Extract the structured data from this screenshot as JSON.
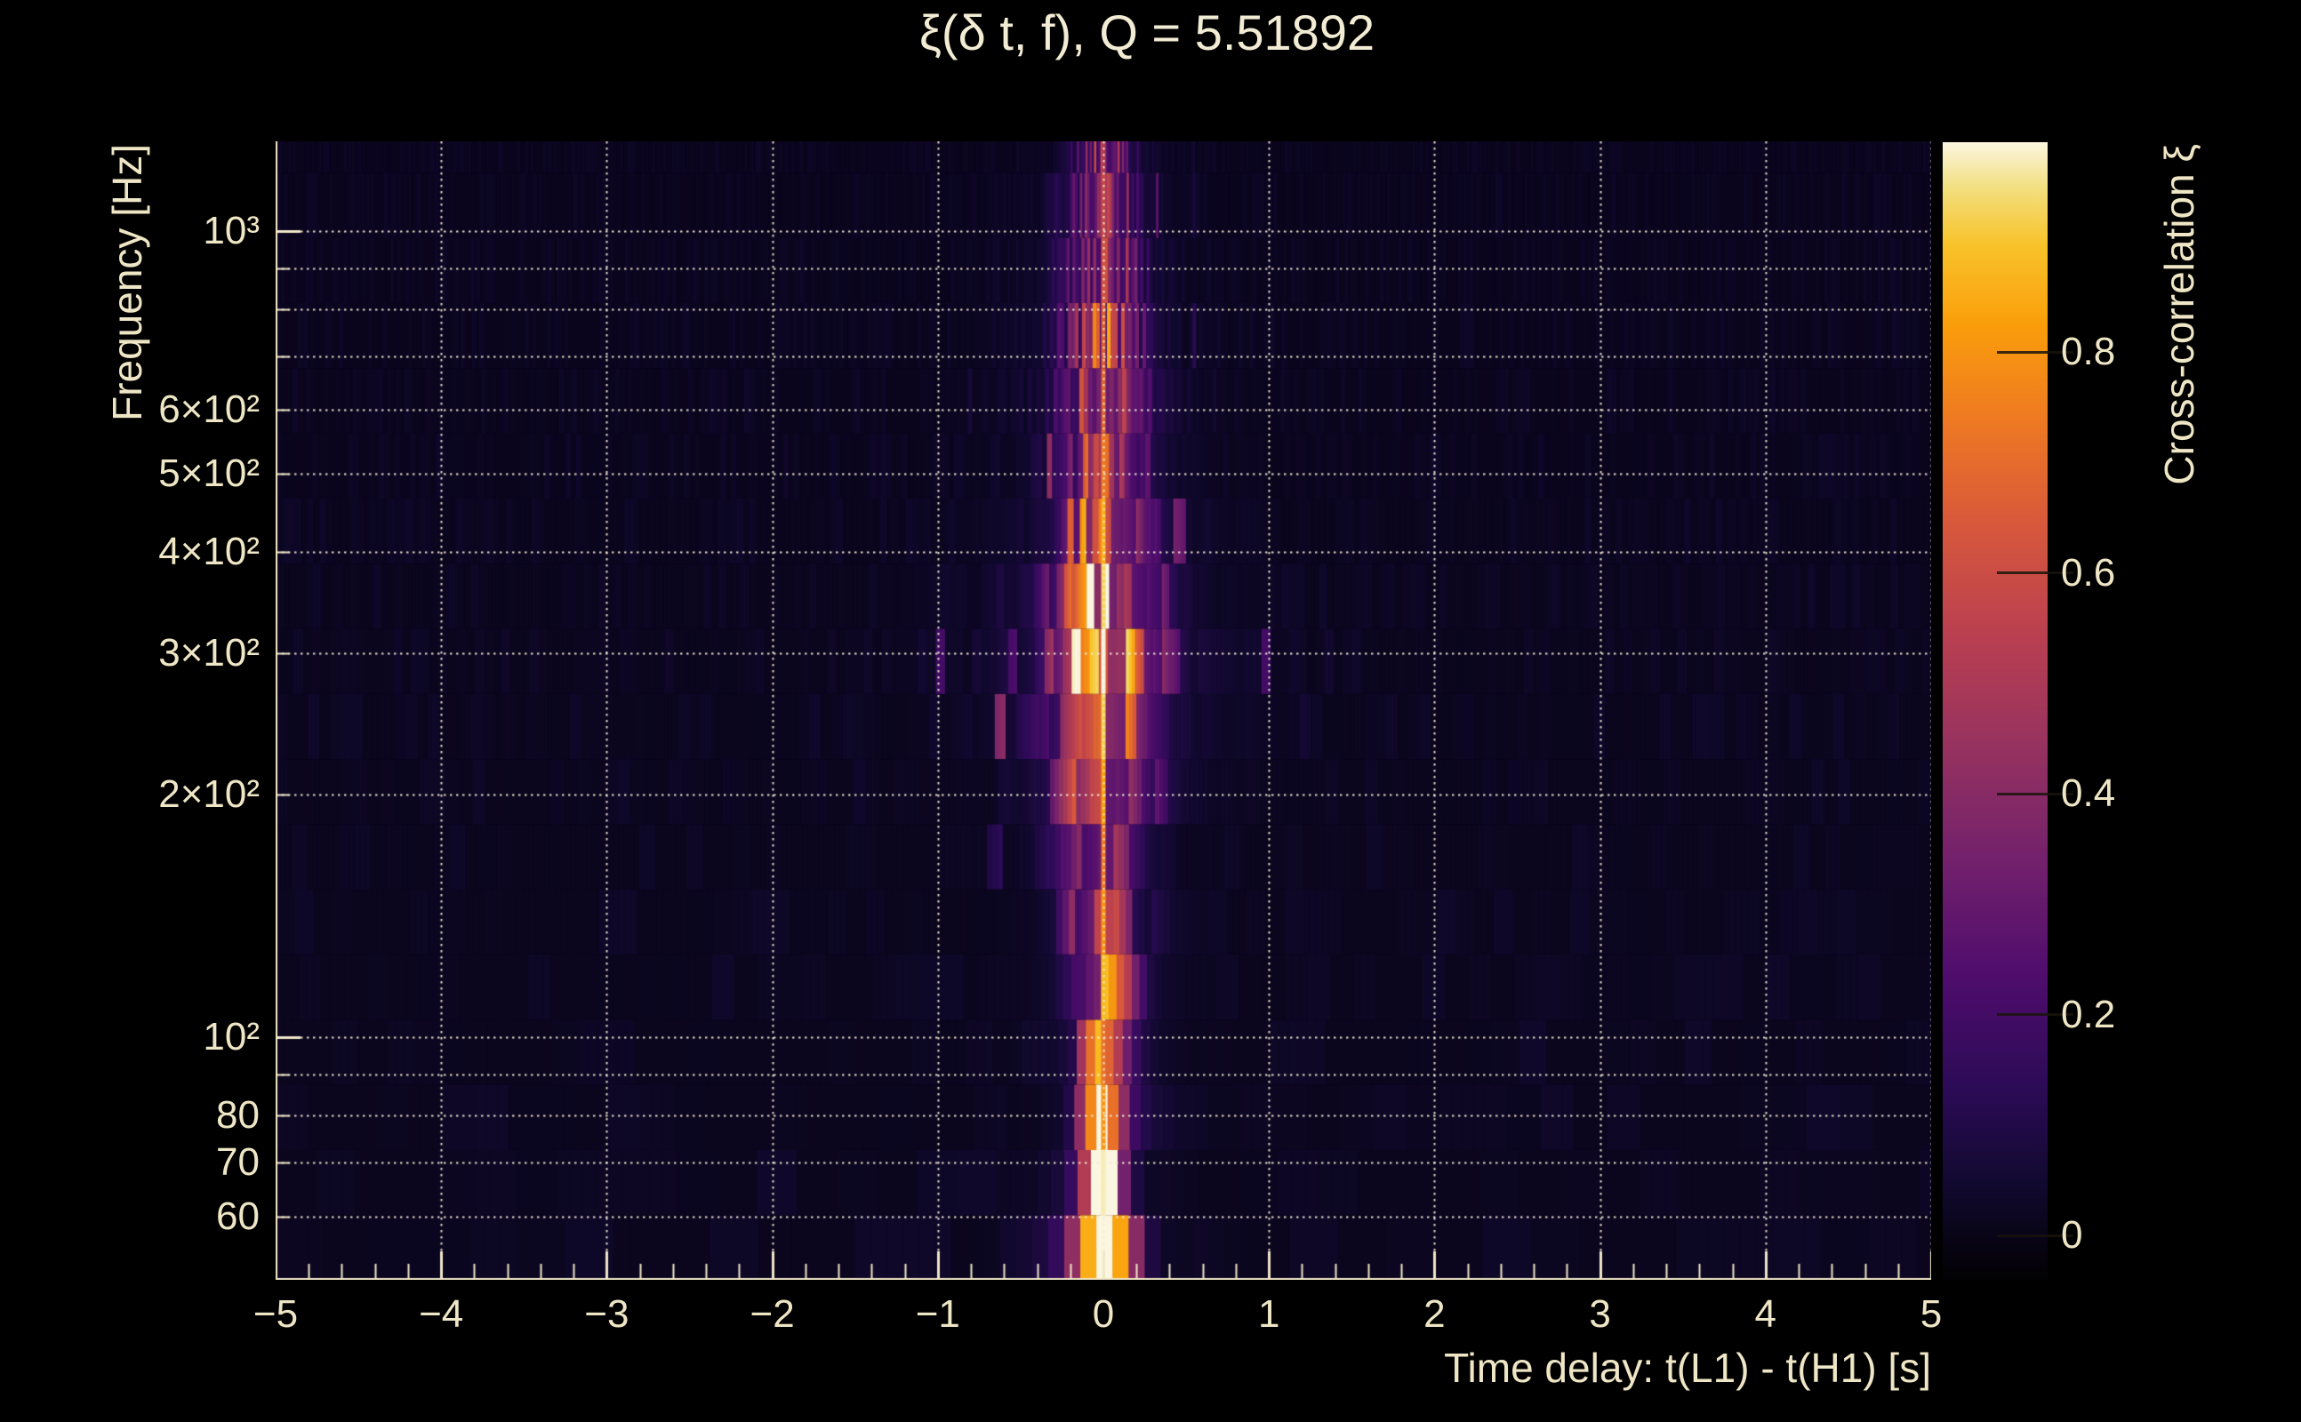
{
  "colors": {
    "background": "#000000",
    "text": "#efe6c6",
    "title_text": "#f3ecd4",
    "grid": "rgba(244,237,215,0.92)",
    "axis": "#efe6c6"
  },
  "chart_data": {
    "type": "heatmap",
    "title": "ξ(δ t, f), Q = 5.51892",
    "q_value": 5.51892,
    "x_axis": {
      "label": "Time delay: t(L1) - t(H1) [s]",
      "min": -5,
      "max": 5,
      "minor_step": 0.2,
      "ticks": [
        {
          "t": -5,
          "label": "−5"
        },
        {
          "t": -4,
          "label": "−4"
        },
        {
          "t": -3,
          "label": "−3"
        },
        {
          "t": -2,
          "label": "−2"
        },
        {
          "t": -1,
          "label": "−1"
        },
        {
          "t": 0,
          "label": "0"
        },
        {
          "t": 1,
          "label": "1"
        },
        {
          "t": 2,
          "label": "2"
        },
        {
          "t": 3,
          "label": "3"
        },
        {
          "t": 4,
          "label": "4"
        },
        {
          "t": 5,
          "label": "5"
        }
      ]
    },
    "y_axis": {
      "label": "Frequency [Hz]",
      "scale": "log",
      "min": 50.3,
      "max": 1293,
      "grid_freqs": [
        60,
        70,
        80,
        90,
        100,
        200,
        300,
        400,
        500,
        600,
        700,
        800,
        900,
        1000
      ],
      "ticks": [
        {
          "f": 1000,
          "label": "10³"
        },
        {
          "f": 600,
          "label": "6×10²"
        },
        {
          "f": 500,
          "label": "5×10²"
        },
        {
          "f": 400,
          "label": "4×10²"
        },
        {
          "f": 300,
          "label": "3×10²"
        },
        {
          "f": 200,
          "label": "2×10²"
        },
        {
          "f": 100,
          "label": "10²"
        },
        {
          "f": 80,
          "label": "80"
        },
        {
          "f": 70,
          "label": "70"
        },
        {
          "f": 60,
          "label": "60"
        }
      ]
    },
    "colorbar": {
      "label": "Cross-correlation ξ",
      "z_min": -0.04,
      "z_max": 0.99,
      "ticks": [
        {
          "v": 0.8,
          "label": "0.8"
        },
        {
          "v": 0.6,
          "label": "0.6"
        },
        {
          "v": 0.4,
          "label": "0.4"
        },
        {
          "v": 0.2,
          "label": "0.2"
        },
        {
          "v": 0.0,
          "label": "0"
        }
      ],
      "palette": [
        {
          "p": 0.0,
          "c": "#020103"
        },
        {
          "p": 0.08,
          "c": "#10092d"
        },
        {
          "p": 0.17,
          "c": "#2c0b57"
        },
        {
          "p": 0.27,
          "c": "#500d6d"
        },
        {
          "p": 0.37,
          "c": "#73216c"
        },
        {
          "p": 0.47,
          "c": "#97325f"
        },
        {
          "p": 0.57,
          "c": "#bb4050"
        },
        {
          "p": 0.67,
          "c": "#d95a3a"
        },
        {
          "p": 0.76,
          "c": "#ef7b21"
        },
        {
          "p": 0.84,
          "c": "#fa9e0b"
        },
        {
          "p": 0.91,
          "c": "#f8c32a"
        },
        {
          "p": 0.96,
          "c": "#f2df7f"
        },
        {
          "p": 1.0,
          "c": "#fbf6e0"
        }
      ]
    },
    "ridge": {
      "t": 0,
      "width_s": 0.027
    },
    "tile_time_constant": 16,
    "seed": 20240915,
    "bands": [
      {
        "f_lo": 50.0,
        "f_hi": 60.2,
        "peak": 0.99,
        "sigma_s": 0.13,
        "noise": 0.25
      },
      {
        "f_lo": 60.2,
        "f_hi": 72.5,
        "peak": 0.97,
        "sigma_s": 0.09,
        "noise": 0.5
      },
      {
        "f_lo": 72.5,
        "f_hi": 87.4,
        "peak": 0.8,
        "sigma_s": 0.1,
        "noise": 1
      },
      {
        "f_lo": 87.4,
        "f_hi": 105.2,
        "peak": 0.72,
        "sigma_s": 0.11,
        "noise": 1
      },
      {
        "f_lo": 105.2,
        "f_hi": 126.8,
        "peak": 0.88,
        "sigma_s": 0.12,
        "noise": 1
      },
      {
        "f_lo": 126.8,
        "f_hi": 152.7,
        "peak": 0.8,
        "sigma_s": 0.13,
        "noise": 1
      },
      {
        "f_lo": 152.7,
        "f_hi": 183.9,
        "peak": 0.74,
        "sigma_s": 0.15,
        "noise": 1
      },
      {
        "f_lo": 183.9,
        "f_hi": 221.5,
        "peak": 0.83,
        "sigma_s": 0.18,
        "noise": 1
      },
      {
        "f_lo": 221.5,
        "f_hi": 266.8,
        "peak": 0.92,
        "sigma_s": 0.21,
        "noise": 1
      },
      {
        "f_lo": 266.8,
        "f_hi": 321.4,
        "peak": 0.99,
        "sigma_s": 0.23,
        "noise": 1
      },
      {
        "f_lo": 321.4,
        "f_hi": 387.1,
        "peak": 0.93,
        "sigma_s": 0.21,
        "noise": 1
      },
      {
        "f_lo": 387.1,
        "f_hi": 466.3,
        "peak": 0.86,
        "sigma_s": 0.17,
        "noise": 1
      },
      {
        "f_lo": 466.3,
        "f_hi": 561.6,
        "peak": 0.74,
        "sigma_s": 0.16,
        "noise": 1
      },
      {
        "f_lo": 561.6,
        "f_hi": 676.5,
        "peak": 0.68,
        "sigma_s": 0.17,
        "noise": 1
      },
      {
        "f_lo": 676.5,
        "f_hi": 814.8,
        "peak": 0.66,
        "sigma_s": 0.16,
        "noise": 1
      },
      {
        "f_lo": 814.8,
        "f_hi": 981.4,
        "peak": 0.62,
        "sigma_s": 0.14,
        "noise": 1
      },
      {
        "f_lo": 981.4,
        "f_hi": 1182.1,
        "peak": 0.58,
        "sigma_s": 0.13,
        "noise": 1
      },
      {
        "f_lo": 1182.1,
        "f_hi": 1293.0,
        "peak": 0.52,
        "sigma_s": 0.11,
        "noise": 1
      }
    ]
  }
}
